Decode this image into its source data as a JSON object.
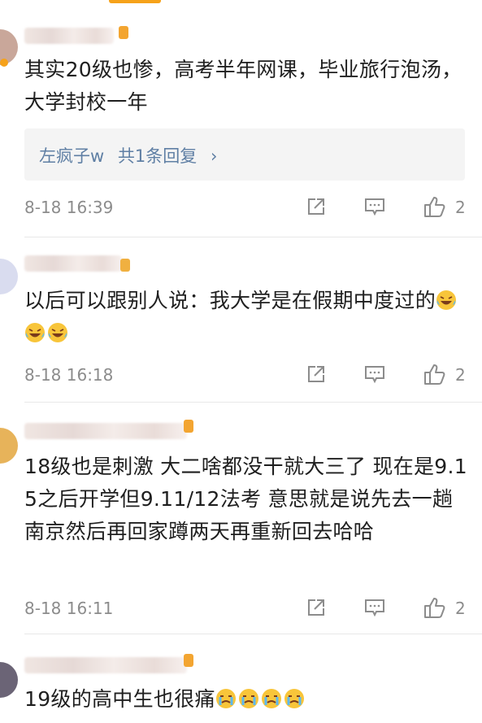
{
  "colors": {
    "accent": "#f6a21a",
    "link": "#5f7fa4",
    "meta": "#8c8c8c"
  },
  "comments": [
    {
      "text": "其实20级也惨，高考半年网课，毕业旅行泡汤，大学封校一年",
      "reply": {
        "author": "左疯子w",
        "label": "共1条回复"
      },
      "time": "8-18 16:39",
      "likes": "2"
    },
    {
      "text": "以后可以跟别人说：我大学是在假期中度过的",
      "emoji": [
        "laugh-cry-emoji",
        "laugh-cry-emoji",
        "laugh-cry-emoji"
      ],
      "time": "8-18 16:18",
      "likes": "2"
    },
    {
      "text": "18级也是刺激 大二啥都没干就大三了 现在是9.15之后开学但9.11/12法考 意思就是说先去一趟南京然后再回家蹲两天再重新回去哈哈",
      "time": "8-18 16:11",
      "likes": "2"
    },
    {
      "text": "19级的高中生也很痛",
      "emoji": [
        "crying-emoji",
        "crying-emoji",
        "crying-emoji",
        "crying-emoji"
      ]
    }
  ],
  "icons": {
    "share": "share-icon",
    "comment": "comment-icon",
    "like": "thumbs-up-icon",
    "reply_arrow": "chevron-right-icon"
  }
}
